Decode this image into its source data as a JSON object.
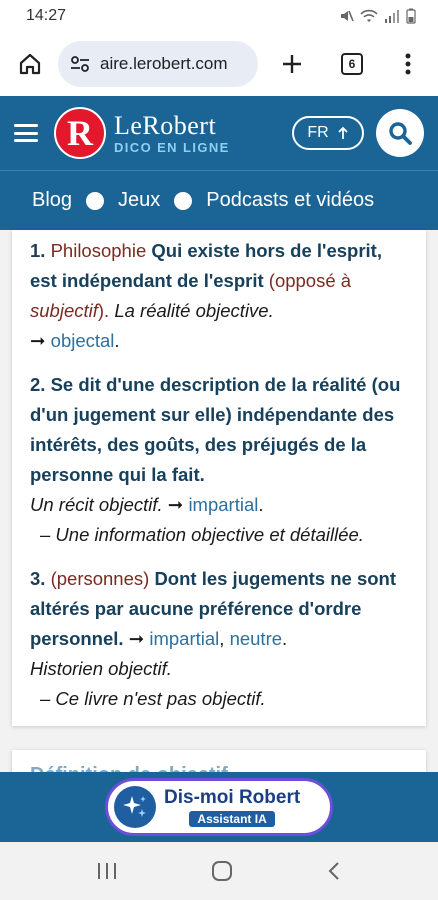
{
  "status_bar": {
    "time": "14:27"
  },
  "browser": {
    "url": "aire.lerobert.com",
    "tab_count": "6"
  },
  "site": {
    "logo_letter": "R",
    "logo_name": "LeRobert",
    "logo_tagline": "DICO EN LIGNE",
    "lang": "FR"
  },
  "nav": {
    "items": [
      "Blog",
      "Jeux",
      "Podcasts et vidéos"
    ]
  },
  "definitions": [
    {
      "num": "1.",
      "domain": "Philosophie",
      "text": "Qui existe hors de l'esprit, est indépendant de l'esprit",
      "paren_open": "(opposé à ",
      "paren_term": "subjectif",
      "paren_close": ").",
      "example": "La réalité objective.",
      "arrow": "➞",
      "link": "objectal",
      "link_end": "."
    },
    {
      "num": "2.",
      "text": "Se dit d'une description de la réalité (ou d'un jugement sur elle) indépendante des intérêts, des goûts, des préjugés de la personne qui la fait.",
      "example": "Un récit objectif.",
      "arrow": "➞",
      "link": "impartial",
      "link_end": ".",
      "example2": "– Une information objective et détaillée."
    },
    {
      "num": "3.",
      "domain": "(personnes)",
      "text": "Dont les jugements ne sont altérés par aucune préférence d'ordre personnel.",
      "arrow": "➞",
      "link1": "impartial",
      "sep": ",",
      "link2": "neutre",
      "link_end": ".",
      "example": "Historien objectif.",
      "example2": "– Ce livre n'est pas objectif."
    }
  ],
  "next_section": {
    "title": "Définition de objectif"
  },
  "assistant": {
    "title": "Dis-moi Robert",
    "subtitle": "Assistant IA"
  }
}
